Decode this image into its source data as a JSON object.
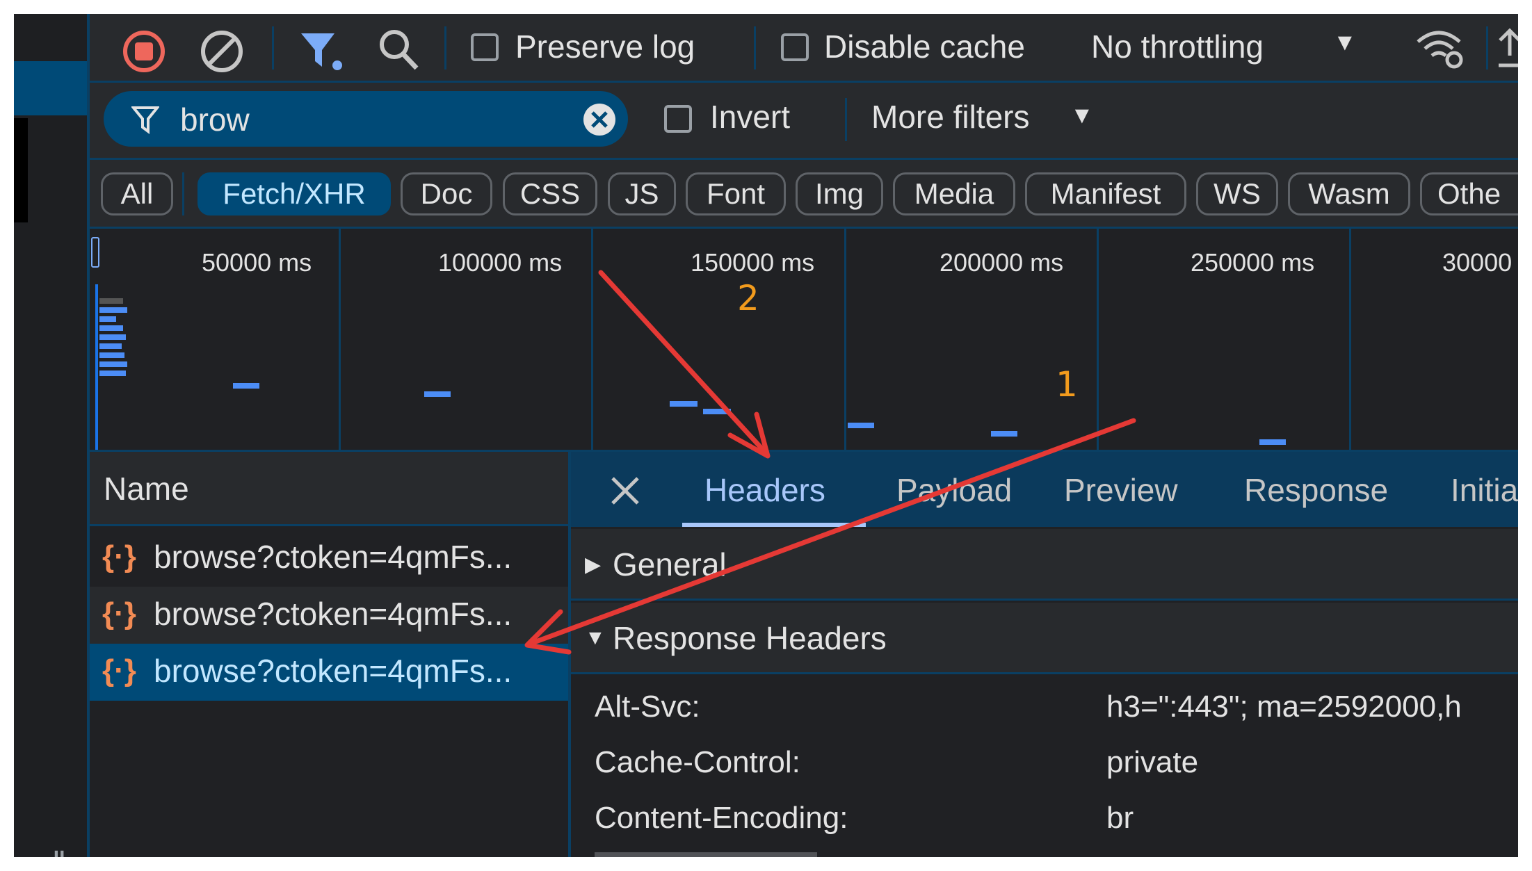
{
  "toolbar": {
    "preserve_log": "Preserve log",
    "disable_cache": "Disable cache",
    "throttling": "No throttling"
  },
  "filter": {
    "value": "brow",
    "invert": "Invert",
    "more_filters": "More filters"
  },
  "types": [
    "All",
    "Fetch/XHR",
    "Doc",
    "CSS",
    "JS",
    "Font",
    "Img",
    "Media",
    "Manifest",
    "WS",
    "Wasm",
    "Othe"
  ],
  "overview": {
    "ticks": [
      "50000 ms",
      "100000 ms",
      "150000 ms",
      "200000 ms",
      "250000 ms",
      "30000"
    ]
  },
  "names": {
    "header": "Name",
    "rows": [
      "browse?ctoken=4qmFs...",
      "browse?ctoken=4qmFs...",
      "browse?ctoken=4qmFs..."
    ]
  },
  "details": {
    "tabs": [
      "Headers",
      "Payload",
      "Preview",
      "Response",
      "Initiat"
    ],
    "general": "General",
    "response_headers": "Response Headers",
    "headers": [
      {
        "name": "Alt-Svc:",
        "value": "h3=\":443\"; ma=2592000,h"
      },
      {
        "name": "Cache-Control:",
        "value": "private"
      },
      {
        "name": "Content-Encoding:",
        "value": "br"
      }
    ]
  },
  "annotations": {
    "label_1": "1",
    "label_2": "2"
  },
  "colors": {
    "accent": "#a8c7fa",
    "selected": "#004a77",
    "annotation_arrow": "#e53935",
    "annotation_number": "#f29b1d"
  }
}
